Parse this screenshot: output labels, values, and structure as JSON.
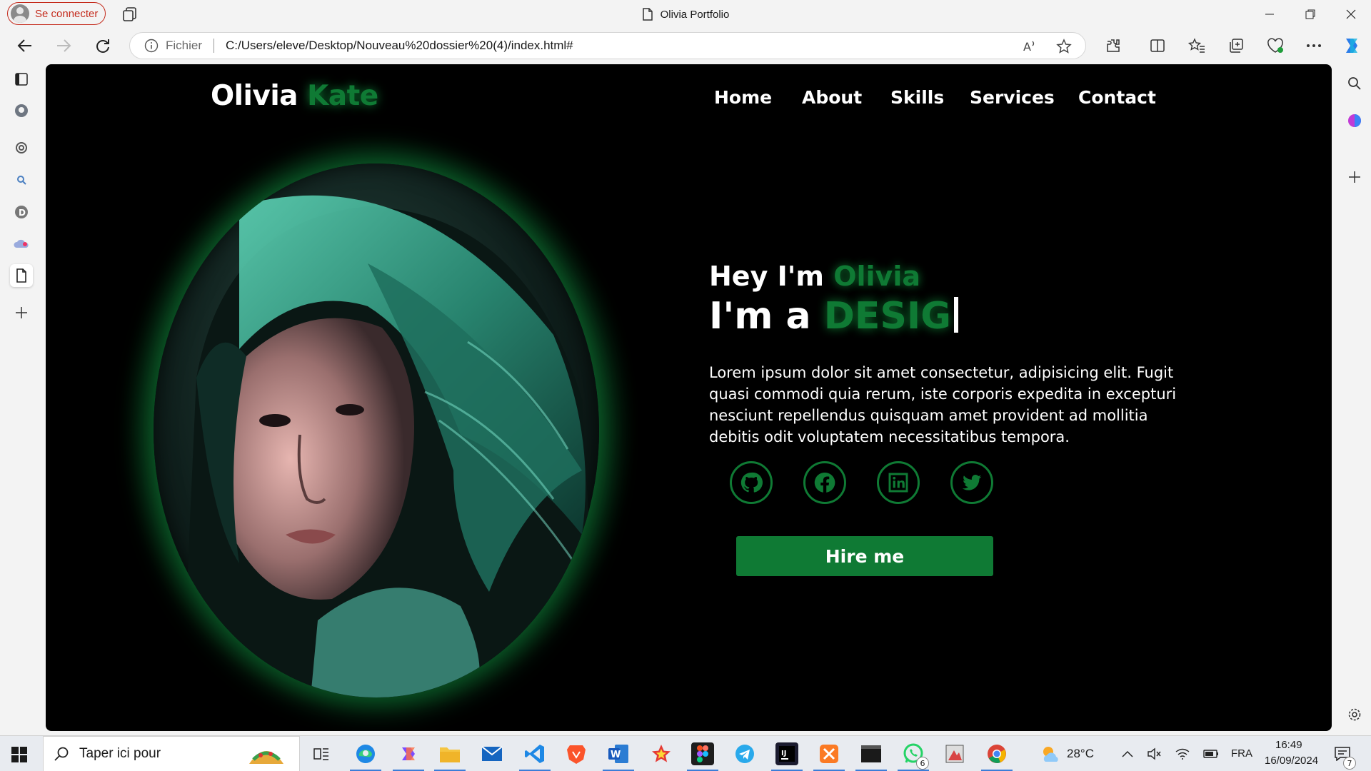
{
  "browser": {
    "profile_label": "Se connecter",
    "tab_title": "Olivia Portfolio",
    "address": {
      "scheme_label": "Fichier",
      "url": "C:/Users/eleve/Desktop/Nouveau%20dossier%20(4)/index.html#"
    }
  },
  "site": {
    "logo_first": "Olivia",
    "logo_second": "Kate",
    "nav": [
      "Home",
      "About",
      "Skills",
      "Services",
      "Contact"
    ],
    "greeting_prefix": "Hey I'm",
    "greeting_name": "Olivia",
    "role_prefix": "I'm a",
    "role_typed": "DESIG",
    "description": "Lorem ipsum dolor sit amet consectetur, adipisicing elit. Fugit quasi commodi quia rerum, iste corporis expedita in excepturi nesciunt repellendus quisquam amet provident ad mollitia debitis odit voluptatem necessitatibus tempora.",
    "social_icons": [
      "github-icon",
      "facebook-icon",
      "linkedin-icon",
      "twitter-icon"
    ],
    "hire_label": "Hire me",
    "colors": {
      "accent": "#0f7a34",
      "background": "#000000",
      "text": "#ffffff"
    }
  },
  "taskbar": {
    "search_placeholder": "Taper ici pour",
    "whatsapp_badge": "6",
    "weather": "28°C",
    "language": "FRA",
    "time": "16:49",
    "date": "16/09/2024",
    "notifications_badge": "7"
  }
}
